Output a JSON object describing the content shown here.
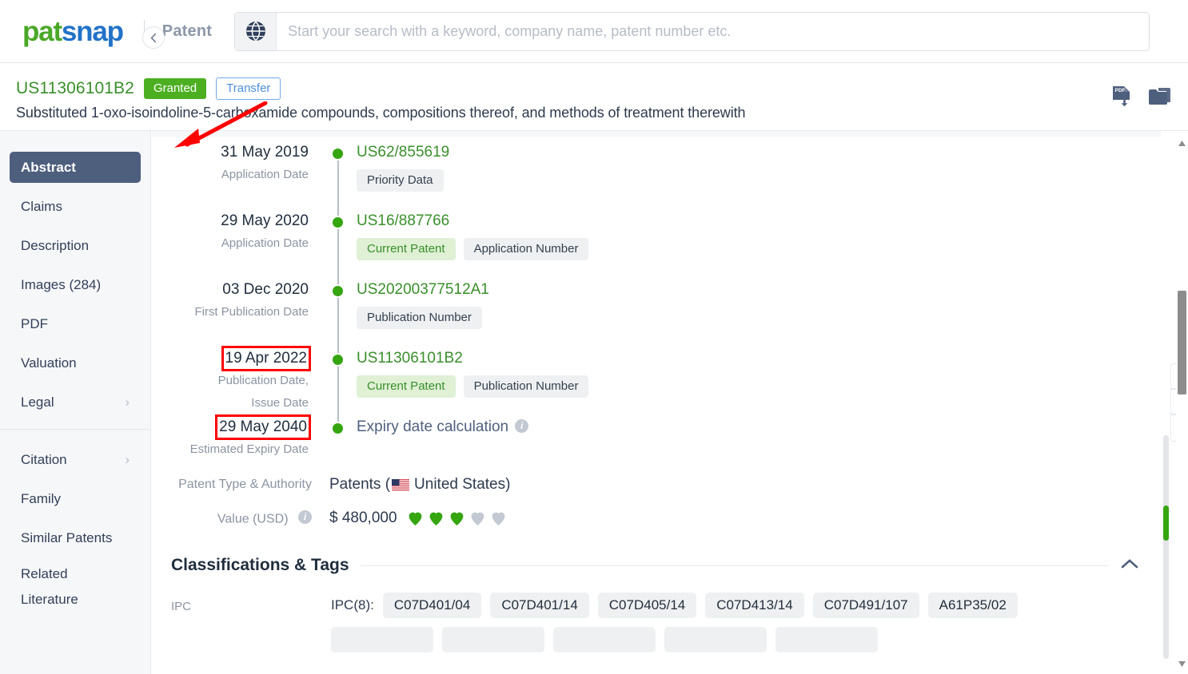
{
  "header": {
    "logo_pat": "pat",
    "logo_snap": "snap",
    "section_name": "Patent",
    "globe_icon": "globe-icon",
    "search": {
      "placeholder": "Start your search with a keyword, company name, patent number etc.",
      "value": ""
    }
  },
  "patent_header": {
    "publication_number": "US11306101B2",
    "status_badge": "Granted",
    "status_badge_color": "#4caf22",
    "transfer_button": "Transfer",
    "title": "Substituted 1-oxo-isoindoline-5-carboxamide compounds, compositions thereof, and methods of treatment therewith",
    "pdf_icon": "pdf-download-icon",
    "folder_icon": "folder-icon",
    "annotation": "red-arrow-pointing-to-granted-badge",
    "annotation_color": "#ff0000"
  },
  "sidebar": {
    "collapse_icon": "chevron-left-icon",
    "items": [
      {
        "label": "Abstract",
        "active": true,
        "has_chevron": false
      },
      {
        "label": "Claims",
        "active": false,
        "has_chevron": false
      },
      {
        "label": "Description",
        "active": false,
        "has_chevron": false
      },
      {
        "label": "Images (284)",
        "active": false,
        "has_chevron": false
      },
      {
        "label": "PDF",
        "active": false,
        "has_chevron": false
      },
      {
        "label": "Valuation",
        "active": false,
        "has_chevron": false
      },
      {
        "label": "Legal",
        "active": false,
        "has_chevron": true
      }
    ],
    "items2": [
      {
        "label": "Citation",
        "active": false,
        "has_chevron": true
      },
      {
        "label": "Family",
        "active": false,
        "has_chevron": false
      },
      {
        "label": "Similar Patents",
        "active": false,
        "has_chevron": false
      }
    ],
    "related_literature_line1": "Related",
    "related_literature_line2": "Literature"
  },
  "timeline": [
    {
      "date": "31 May 2019",
      "boxed": false,
      "sub": "Application Date",
      "sub2": "",
      "number": "US62/855619",
      "number_style": "green",
      "tags": [
        {
          "label": "Priority Data",
          "green": false
        }
      ]
    },
    {
      "date": "29 May 2020",
      "boxed": false,
      "sub": "Application Date",
      "sub2": "",
      "number": "US16/887766",
      "number_style": "green",
      "tags": [
        {
          "label": "Current Patent",
          "green": true
        },
        {
          "label": "Application Number",
          "green": false
        }
      ]
    },
    {
      "date": "03 Dec 2020",
      "boxed": false,
      "sub": "First Publication Date",
      "sub2": "",
      "number": "US20200377512A1",
      "number_style": "green",
      "tags": [
        {
          "label": "Publication Number",
          "green": false
        }
      ]
    },
    {
      "date": "19 Apr 2022",
      "boxed": true,
      "sub": "Publication Date,",
      "sub2": "Issue Date",
      "number": "US11306101B2",
      "number_style": "green",
      "tags": [
        {
          "label": "Current Patent",
          "green": true
        },
        {
          "label": "Publication Number",
          "green": false
        }
      ]
    },
    {
      "date": "29 May 2040",
      "boxed": true,
      "sub": "Estimated Expiry Date",
      "sub2": "",
      "number": "Expiry date calculation",
      "number_style": "plain",
      "number_info_icon": "info-icon",
      "tags": []
    }
  ],
  "meta": {
    "patent_type_label": "Patent Type & Authority",
    "patent_type_prefix": "Patents (",
    "patent_type_country": "United States)",
    "flag_icon": "us-flag-icon",
    "value_label": "Value (USD)",
    "value_info_icon": "info-icon",
    "value_amount": "$ 480,000",
    "gem_icon": "gem-icon",
    "gems_filled": 3,
    "gems_total": 5,
    "gem_filled_color": "#35a510",
    "gem_empty_color": "#c3c9d2"
  },
  "classifications": {
    "section_title": "Classifications & Tags",
    "collapse_icon": "chevron-up-icon",
    "rows": [
      {
        "key": "IPC",
        "prefix": "IPC(8):",
        "tags_row1": [
          "C07D401/04",
          "C07D401/14",
          "C07D405/14",
          "C07D413/14",
          "C07D491/107",
          "A61P35/02"
        ],
        "tags_row2": [
          "",
          "",
          "",
          "",
          ""
        ]
      }
    ]
  },
  "scroll": {
    "browser_scrollbar": "vertical-scrollbar",
    "inner_scrollbar": "inner-vertical-scrollbar",
    "inner_thumb_color": "#35a510"
  }
}
